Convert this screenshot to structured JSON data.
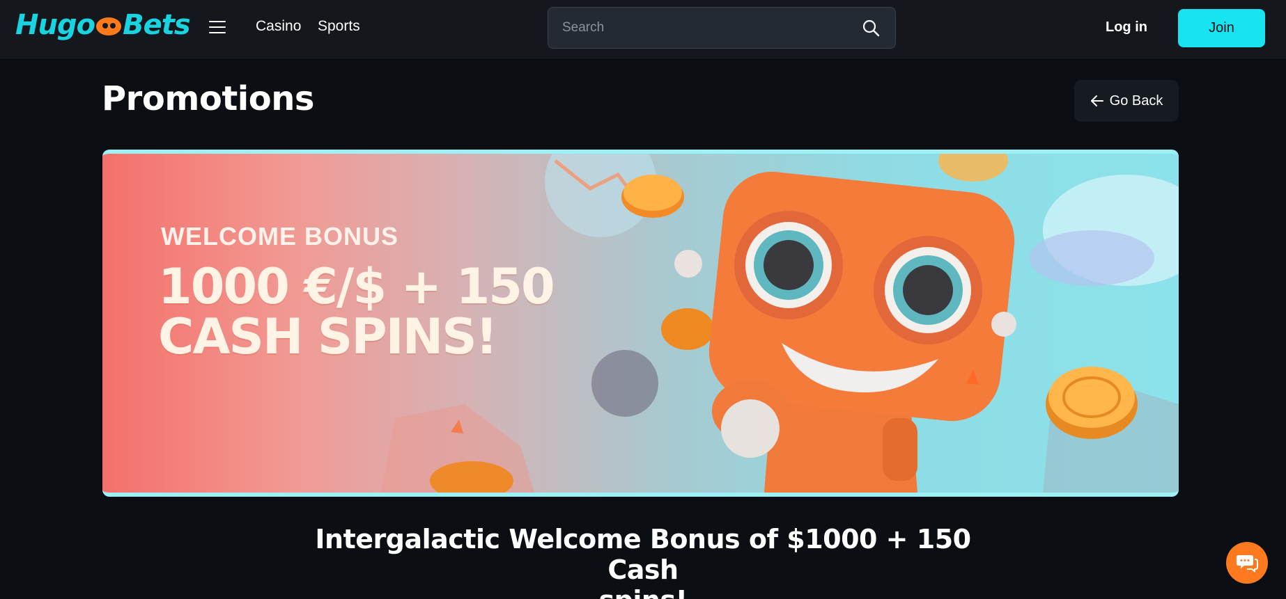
{
  "header": {
    "logo_text_left": "Hugo",
    "logo_text_right": "Bets",
    "nav": {
      "casino": "Casino",
      "sports": "Sports"
    },
    "search_placeholder": "Search",
    "login_label": "Log in",
    "join_label": "Join"
  },
  "page": {
    "title": "Promotions",
    "go_back_label": "Go Back"
  },
  "banner": {
    "eyebrow": "WELCOME BONUS",
    "line1": "1000 €/$ + 150",
    "line2": "CASH SPINS!"
  },
  "promo": {
    "heading_line1": "Intergalactic Welcome Bonus of $1000 + 150 Cash",
    "heading_line2": "spins!"
  },
  "colors": {
    "accent": "#18e3f0",
    "chat": "#ff7a1f",
    "background": "#0b0e12"
  },
  "icons": [
    "menu-icon",
    "search-icon",
    "arrow-left-icon",
    "chat-icon"
  ]
}
